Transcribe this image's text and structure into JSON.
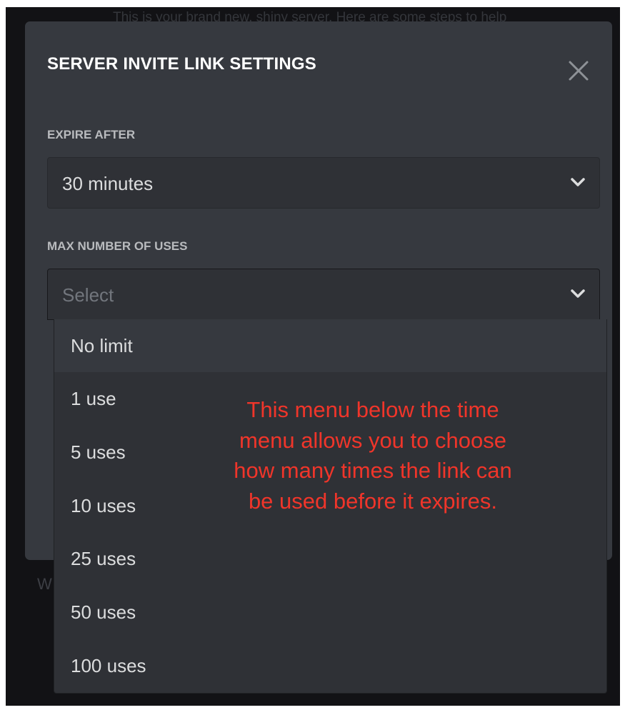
{
  "background": {
    "top_text": "This is your brand new, shiny server. Here are some steps to help",
    "fragment": "W"
  },
  "modal": {
    "title": "SERVER INVITE LINK SETTINGS",
    "close_icon": "close-icon"
  },
  "expire": {
    "label": "EXPIRE AFTER",
    "value": "30 minutes",
    "icon": "chevron-down-icon"
  },
  "max_uses": {
    "label": "MAX NUMBER OF USES",
    "placeholder": "Select",
    "icon": "chevron-down-icon",
    "options": [
      "No limit",
      "1 use",
      "5 uses",
      "10 uses",
      "25 uses",
      "50 uses",
      "100 uses"
    ]
  },
  "annotation": {
    "text": "This menu below the time menu allows you to choose how many times the link can be used before it expires.",
    "color": "#f0352a"
  },
  "colors": {
    "modal_bg": "#36393f",
    "input_bg": "#2f3136",
    "text_primary": "#ffffff",
    "text_label": "#b9bbbe"
  }
}
